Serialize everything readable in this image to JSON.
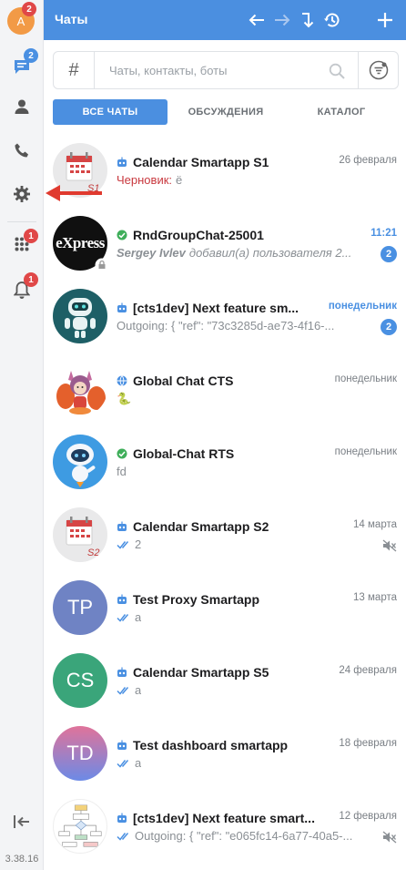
{
  "app": {
    "title": "Чаты",
    "version": "3.38.16"
  },
  "rail": {
    "avatar_letter": "А",
    "avatar_badge": "2",
    "chats_badge": "2",
    "apps_badge": "1",
    "notifications_badge": "1"
  },
  "search": {
    "hash": "#",
    "placeholder": "Чаты, контакты, боты",
    "value": ""
  },
  "tabs": [
    {
      "label": "ВСЕ ЧАТЫ",
      "active": true
    },
    {
      "label": "ОБСУЖДЕНИЯ",
      "active": false
    },
    {
      "label": "КАТАЛОГ",
      "active": false
    }
  ],
  "chats": [
    {
      "name": "Calendar Smartapp S1",
      "kind": "bot",
      "date": "26 февраля",
      "draft_label": "Черновик:",
      "preview": "ё",
      "avatar": {
        "type": "calendar",
        "label": "S1"
      }
    },
    {
      "name": "RndGroupChat-25001",
      "kind": "group",
      "date": "11:21",
      "date_highlight": true,
      "author": "Sergey Ivlev",
      "preview": "добавил(а) пользователя 2...",
      "unread": "2",
      "avatar": {
        "type": "express",
        "label": "eXpress"
      }
    },
    {
      "name": "[cts1dev] Next feature sm...",
      "kind": "bot",
      "date": "понедельник",
      "date_highlight": true,
      "preview": "Outgoing: { \"ref\": \"73c3285d-ae73-4f16-...",
      "unread": "2",
      "avatar": {
        "type": "robot-teal"
      }
    },
    {
      "name": "Global Chat CTS",
      "kind": "globe",
      "date": "понедельник",
      "preview": "🐍",
      "avatar": {
        "type": "fox"
      }
    },
    {
      "name": "Global-Chat RTS",
      "kind": "group",
      "date": "понедельник",
      "preview": "fd",
      "avatar": {
        "type": "robot-blue"
      }
    },
    {
      "name": "Calendar Smartapp S2",
      "kind": "bot",
      "date": "14 марта",
      "preview": "2",
      "read": true,
      "muted": true,
      "avatar": {
        "type": "calendar",
        "label": "S2"
      }
    },
    {
      "name": "Test Proxy Smartapp",
      "kind": "bot",
      "date": "13 марта",
      "preview": "a",
      "read": true,
      "avatar": {
        "type": "initials",
        "label": "TP",
        "color": "#6f83c4"
      }
    },
    {
      "name": "Calendar Smartapp S5",
      "kind": "bot",
      "date": "24 февраля",
      "preview": "a",
      "read": true,
      "avatar": {
        "type": "initials",
        "label": "CS",
        "color": "#3aa57a"
      }
    },
    {
      "name": "Test dashboard smartapp",
      "kind": "bot",
      "date": "18 февраля",
      "preview": "a",
      "read": true,
      "avatar": {
        "type": "initials",
        "label": "TD",
        "gradient": [
          "#e0739a",
          "#6c8ae6"
        ]
      }
    },
    {
      "name": "[cts1dev] Next feature smart...",
      "kind": "bot",
      "date": "12 февраля",
      "preview": "Outgoing: { \"ref\": \"e065fc14-6a77-40a5-...",
      "read": true,
      "muted": true,
      "avatar": {
        "type": "diagram"
      }
    }
  ],
  "colors": {
    "accent": "#4b8fe0",
    "badge_red": "#e04848",
    "badge_blue": "#4a90e2",
    "draft": "#c8373d",
    "arrow": "#e03a2f"
  }
}
